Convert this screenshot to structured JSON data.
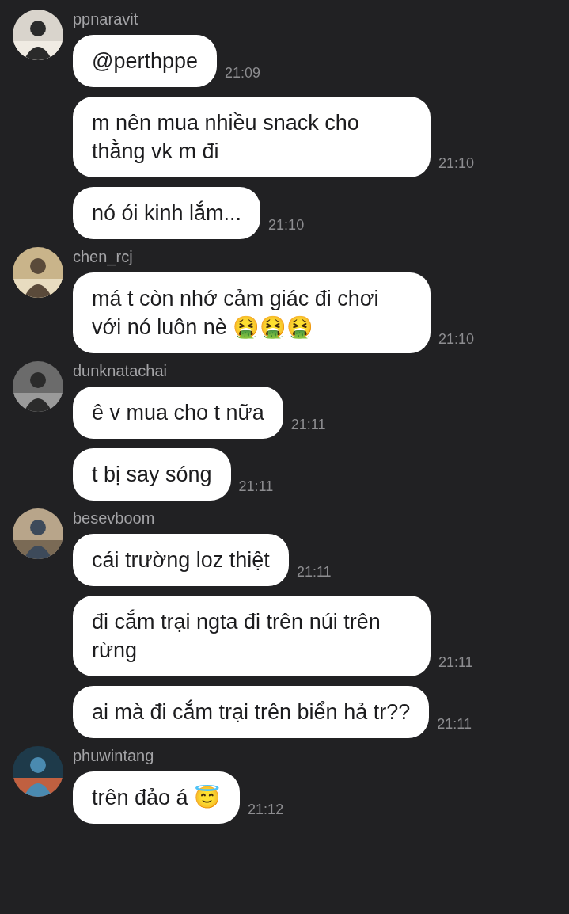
{
  "groups": [
    {
      "sender": "ppnaravit",
      "avatar": {
        "kind": "picture"
      },
      "messages": [
        {
          "text": "@perthppe",
          "time": "21:09"
        },
        {
          "text": "m nên mua nhiều snack cho thằng vk m đi",
          "time": "21:10"
        },
        {
          "text": "nó ói kinh lắm...",
          "time": "21:10"
        }
      ]
    },
    {
      "sender": "chen_rcj",
      "avatar": {
        "kind": "picture"
      },
      "messages": [
        {
          "text": "má t còn nhớ cảm giác đi chơi với nó luôn nè 🤮🤮🤮",
          "time": "21:10"
        }
      ]
    },
    {
      "sender": "dunknatachai",
      "avatar": {
        "kind": "picture"
      },
      "messages": [
        {
          "text": "ê v mua cho t nữa",
          "time": "21:11"
        },
        {
          "text": "t bị say sóng",
          "time": "21:11"
        }
      ]
    },
    {
      "sender": "besevboom",
      "avatar": {
        "kind": "picture"
      },
      "messages": [
        {
          "text": "cái trường loz thiệt",
          "time": "21:11"
        },
        {
          "text": "đi cắm trại ngta đi trên núi trên rừng",
          "time": "21:11"
        },
        {
          "text": "ai mà đi cắm trại trên biển hả tr??",
          "time": "21:11"
        }
      ]
    },
    {
      "sender": "phuwintang",
      "avatar": {
        "kind": "picture"
      },
      "messages": [
        {
          "text": "trên đảo á 😇",
          "time": "21:12"
        }
      ]
    }
  ]
}
